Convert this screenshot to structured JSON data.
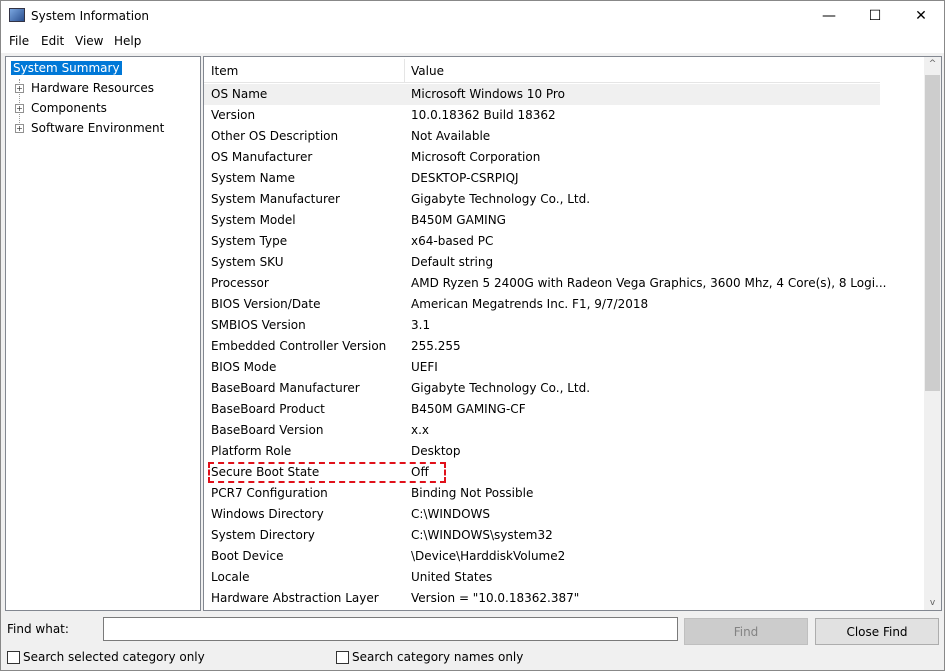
{
  "window": {
    "title": "System Information",
    "minimize": "—",
    "maximize": "☐",
    "close": "✕"
  },
  "menu": [
    "File",
    "Edit",
    "View",
    "Help"
  ],
  "tree": {
    "root": "System Summary",
    "children": [
      "Hardware Resources",
      "Components",
      "Software Environment"
    ]
  },
  "table": {
    "headers": [
      "Item",
      "Value"
    ],
    "rows": [
      [
        "OS Name",
        "Microsoft Windows 10 Pro"
      ],
      [
        "Version",
        "10.0.18362 Build 18362"
      ],
      [
        "Other OS Description",
        "Not Available"
      ],
      [
        "OS Manufacturer",
        "Microsoft Corporation"
      ],
      [
        "System Name",
        "DESKTOP-CSRPIQJ"
      ],
      [
        "System Manufacturer",
        "Gigabyte Technology Co., Ltd."
      ],
      [
        "System Model",
        "B450M GAMING"
      ],
      [
        "System Type",
        "x64-based PC"
      ],
      [
        "System SKU",
        "Default string"
      ],
      [
        "Processor",
        "AMD Ryzen 5 2400G with Radeon Vega Graphics, 3600 Mhz, 4 Core(s), 8 Logi..."
      ],
      [
        "BIOS Version/Date",
        "American Megatrends Inc. F1, 9/7/2018"
      ],
      [
        "SMBIOS Version",
        "3.1"
      ],
      [
        "Embedded Controller Version",
        "255.255"
      ],
      [
        "BIOS Mode",
        "UEFI"
      ],
      [
        "BaseBoard Manufacturer",
        "Gigabyte Technology Co., Ltd."
      ],
      [
        "BaseBoard Product",
        "B450M GAMING-CF"
      ],
      [
        "BaseBoard Version",
        "x.x"
      ],
      [
        "Platform Role",
        "Desktop"
      ],
      [
        "Secure Boot State",
        "Off"
      ],
      [
        "PCR7 Configuration",
        "Binding Not Possible"
      ],
      [
        "Windows Directory",
        "C:\\WINDOWS"
      ],
      [
        "System Directory",
        "C:\\WINDOWS\\system32"
      ],
      [
        "Boot Device",
        "\\Device\\HarddiskVolume2"
      ],
      [
        "Locale",
        "United States"
      ],
      [
        "Hardware Abstraction Layer",
        "Version = \"10.0.18362.387\""
      ]
    ]
  },
  "find": {
    "label": "Find what:",
    "value": "",
    "find_button": "Find",
    "close_button": "Close Find",
    "check1": "Search selected category only",
    "check2": "Search category names only"
  },
  "colors": {
    "selection": "#0078d7",
    "highlight": "#e0101a"
  }
}
